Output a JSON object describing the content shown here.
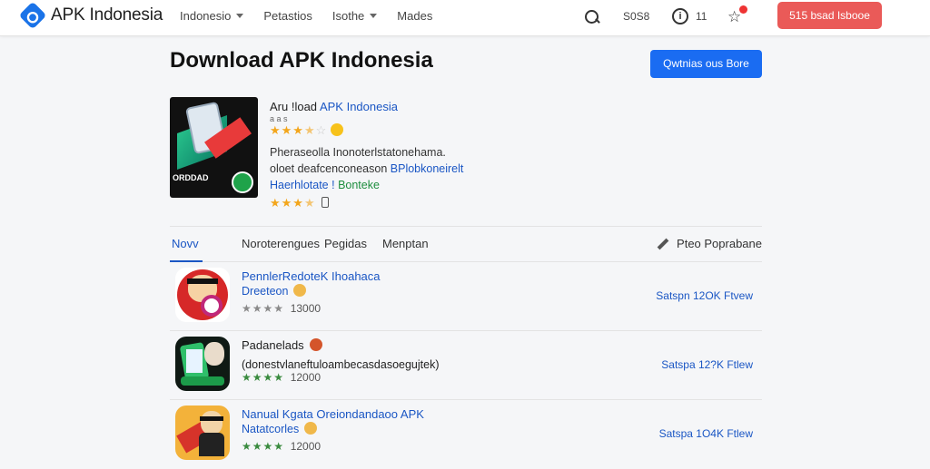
{
  "header": {
    "logo_text": "APK Indonesia",
    "nav": [
      {
        "label": "Indonesio",
        "has_dropdown": true
      },
      {
        "label": "Petastios",
        "has_dropdown": false
      },
      {
        "label": "Isothe",
        "has_dropdown": true
      },
      {
        "label": "Mades",
        "has_dropdown": false
      }
    ],
    "stat_text": "S0S8",
    "info_count": "11",
    "cta_label": "515 bsad Isbooe"
  },
  "main": {
    "page_title": "Download APK Indonesia",
    "primary_button": "Qwtnias ous Bore"
  },
  "featured": {
    "title_prefix": "Aru !load",
    "title_link": "APK Indonesia",
    "small_label": "a a s",
    "rating_stars_filled": 3.5,
    "rating_stars_total": 5,
    "desc_line1": "Pheraseolla Inonoterlstatonehama.",
    "desc_line2_plain": "oloet deafcenconeason",
    "desc_line2_link": "BPlobkoneirelt",
    "tag_link": "Haerhlotate !",
    "tag_green": "Bonteke",
    "second_rating_filled": 3.5,
    "icon_caption": "ORDDAD"
  },
  "tabs": {
    "items": [
      "Novv",
      "Noroterengues",
      "Pegidas",
      "Menptan"
    ],
    "active_index": 0,
    "action_label": "Pteo Poprabane"
  },
  "apps": [
    {
      "name": "PennlerRedoteK Ihoahaca",
      "subtitle": "Dreeteon",
      "rating_filled": 3,
      "rating_count": "13000",
      "size_label": "Satspn 12OK  Ftvew",
      "name_color": "#1a56c4",
      "subtitle_color": "#1a56c4",
      "rating_color": "gray"
    },
    {
      "name": "Padanelads",
      "subtitle": "(donestvlaneftuloambecasdasoegujtek)",
      "rating_filled": 4,
      "rating_count": "12000",
      "size_label": "Satspa 12?K  Ftlew",
      "name_color": "#222222",
      "subtitle_color": "#222222",
      "rating_color": "green"
    },
    {
      "name": "Nanual Kgata Oreiondandaoo APK",
      "subtitle": "Natatcorles",
      "rating_filled": 4,
      "rating_count": "12000",
      "size_label": "Satspa 1O4K  Ftlew",
      "name_color": "#1a56c4",
      "subtitle_color": "#1a56c4",
      "rating_color": "green"
    }
  ],
  "colors": {
    "accent_blue": "#1a6cf2",
    "cta_red": "#ea5a58",
    "star_gold": "#f3a61c",
    "link_blue": "#1a56c4"
  }
}
